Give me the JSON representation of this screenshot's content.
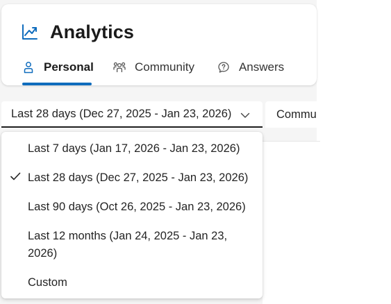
{
  "header": {
    "title": "Analytics",
    "title_icon": "trend-up-icon",
    "accent_color": "#0f6cbd"
  },
  "tabs": [
    {
      "label": "Personal",
      "icon": "person-icon",
      "active": true
    },
    {
      "label": "Community",
      "icon": "people-community-icon",
      "active": false
    },
    {
      "label": "Answers",
      "icon": "chat-help-icon",
      "active": false
    }
  ],
  "filters": {
    "date_range": {
      "selected": "Last 28 days (Dec 27, 2025 - Jan 23, 2026)",
      "expanded": true,
      "options": [
        {
          "label": "Last 7 days (Jan 17, 2026 - Jan 23, 2026)",
          "selected": false
        },
        {
          "label": "Last 28 days (Dec 27, 2025 - Jan 23, 2026)",
          "selected": true
        },
        {
          "label": "Last 90 days (Oct 26, 2025 - Jan 23, 2026)",
          "selected": false
        },
        {
          "label": "Last 12 months (Jan 24, 2025 - Jan 23, 2026)",
          "selected": false
        },
        {
          "label": "Custom",
          "selected": false
        }
      ]
    },
    "community": {
      "selected": "Community"
    }
  }
}
